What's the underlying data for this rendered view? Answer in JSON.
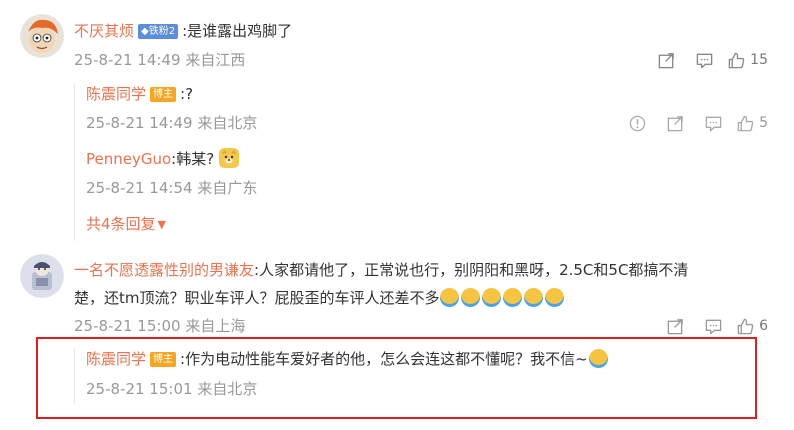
{
  "comments": [
    {
      "username": "不厌其烦",
      "badge": "铁粉2",
      "text": ":是谁露出鸡脚了",
      "timestamp": "25-8-21 14:49",
      "location": "来自江西",
      "likes": "15",
      "replies": [
        {
          "username": "陈震同学",
          "badge": "博主",
          "text": ":?",
          "timestamp": "25-8-21 14:49",
          "location": "来自北京",
          "likes": "5"
        },
        {
          "username": "PenneyGuo",
          "text": ":韩某?",
          "timestamp": "25-8-21 14:54",
          "location": "来自广东"
        }
      ],
      "more_replies": "共4条回复"
    },
    {
      "username": "一名不愿透露性别的男谦友",
      "text_line1": ":人家都请他了，正常说也行，别阴阳和黑呀，2.5C和5C都搞不清",
      "text_line2": "楚，还tm顶流？职业车评人？屁股歪的车评人还差不多",
      "timestamp": "25-8-21 15:00",
      "location": "来自上海",
      "likes": "6",
      "replies": [
        {
          "username": "陈震同学",
          "badge": "博主",
          "text": ":作为电动性能车爱好者的他，怎么会连这都不懂呢？我不信~",
          "timestamp": "25-8-21 15:01",
          "location": "来自北京"
        }
      ]
    }
  ],
  "colors": {
    "username": "#eb7350",
    "meta": "#999999",
    "highlight": "#e02020"
  }
}
